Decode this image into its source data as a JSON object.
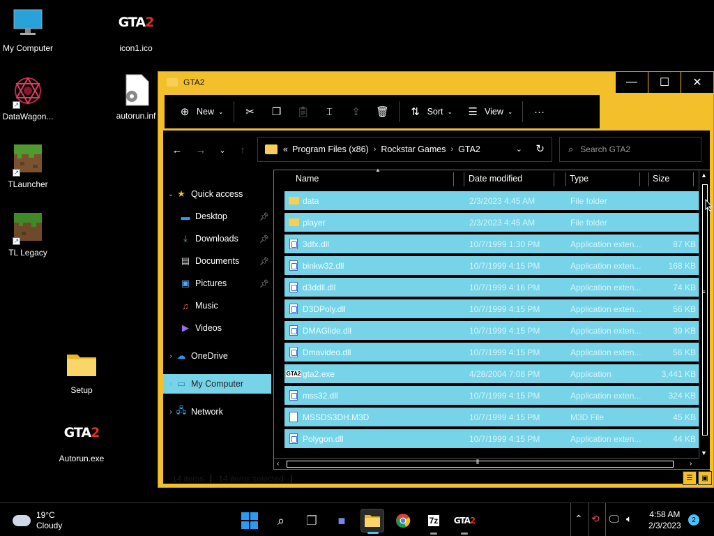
{
  "desktop": {
    "icons": [
      {
        "label": "My Computer",
        "icon": "monitor-icon"
      },
      {
        "label": "DataWagon...",
        "icon": "datawagon-icon"
      },
      {
        "label": "TLauncher",
        "icon": "grass-block-icon"
      },
      {
        "label": "TL Legacy",
        "icon": "grass-block-icon"
      },
      {
        "label": "icon1.ico",
        "icon": "gta2-logo-icon"
      },
      {
        "label": "autorun.inf",
        "icon": "settings-file-icon"
      },
      {
        "label": "Setup",
        "icon": "folder-icon"
      },
      {
        "label": "Autorun.exe",
        "icon": "gta2-logo-icon"
      }
    ]
  },
  "window": {
    "title": "GTA2",
    "controls": {
      "minimize": "—",
      "maximize": "☐",
      "close": "✕"
    },
    "toolbar": {
      "new_label": "New",
      "sort_label": "Sort",
      "view_label": "View",
      "more_label": "···"
    },
    "address": {
      "overflow": "«",
      "crumbs": [
        "Program Files (x86)",
        "Rockstar Games",
        "GTA2"
      ]
    },
    "search": {
      "placeholder": "Search GTA2"
    },
    "nav": {
      "quick_access": "Quick access",
      "items": [
        "Desktop",
        "Downloads",
        "Documents",
        "Pictures",
        "Music",
        "Videos"
      ],
      "onedrive": "OneDrive",
      "my_computer": "My Computer",
      "network": "Network"
    },
    "columns": {
      "name": "Name",
      "date": "Date modified",
      "type": "Type",
      "size": "Size"
    },
    "files": [
      {
        "name": "data",
        "date": "2/3/2023 4:45 AM",
        "type": "File folder",
        "size": "",
        "kind": "folder"
      },
      {
        "name": "player",
        "date": "2/3/2023 4:45 AM",
        "type": "File folder",
        "size": "",
        "kind": "folder"
      },
      {
        "name": "3dfx.dll",
        "date": "10/7/1999 1:30 PM",
        "type": "Application exten...",
        "size": "87 KB",
        "kind": "dll"
      },
      {
        "name": "binkw32.dll",
        "date": "10/7/1999 4:15 PM",
        "type": "Application exten...",
        "size": "168 KB",
        "kind": "dll"
      },
      {
        "name": "d3ddll.dll",
        "date": "10/7/1999 4:16 PM",
        "type": "Application exten...",
        "size": "74 KB",
        "kind": "dll"
      },
      {
        "name": "D3DPoly.dll",
        "date": "10/7/1999 4:15 PM",
        "type": "Application exten...",
        "size": "56 KB",
        "kind": "dll"
      },
      {
        "name": "DMAGlide.dll",
        "date": "10/7/1999 4:15 PM",
        "type": "Application exten...",
        "size": "39 KB",
        "kind": "dll"
      },
      {
        "name": "Dmavideo.dll",
        "date": "10/7/1999 4:15 PM",
        "type": "Application exten...",
        "size": "56 KB",
        "kind": "dll"
      },
      {
        "name": "gta2.exe",
        "date": "4/28/2004 7:08 PM",
        "type": "Application",
        "size": "3,441 KB",
        "kind": "exe"
      },
      {
        "name": "mss32.dll",
        "date": "10/7/1999 4:15 PM",
        "type": "Application exten...",
        "size": "324 KB",
        "kind": "dll"
      },
      {
        "name": "MSSDS3DH.M3D",
        "date": "10/7/1999 4:15 PM",
        "type": "M3D File",
        "size": "45 KB",
        "kind": "file"
      },
      {
        "name": "Polygon.dll",
        "date": "10/7/1999 4:15 PM",
        "type": "Application exten...",
        "size": "44 KB",
        "kind": "dll"
      }
    ],
    "status": {
      "count": "14 items",
      "selected": "14 items selected"
    }
  },
  "taskbar": {
    "weather": {
      "temp": "19°C",
      "condition": "Cloudy"
    },
    "apps": [
      "start",
      "search",
      "task-view",
      "teams-chat",
      "file-explorer",
      "chrome",
      "7zip",
      "gta2"
    ],
    "time": "4:58 AM",
    "date": "2/3/2023",
    "notifications": "2"
  },
  "colors": {
    "accent": "#f3c02b",
    "selection": "#77d4e8",
    "background": "#000000"
  }
}
